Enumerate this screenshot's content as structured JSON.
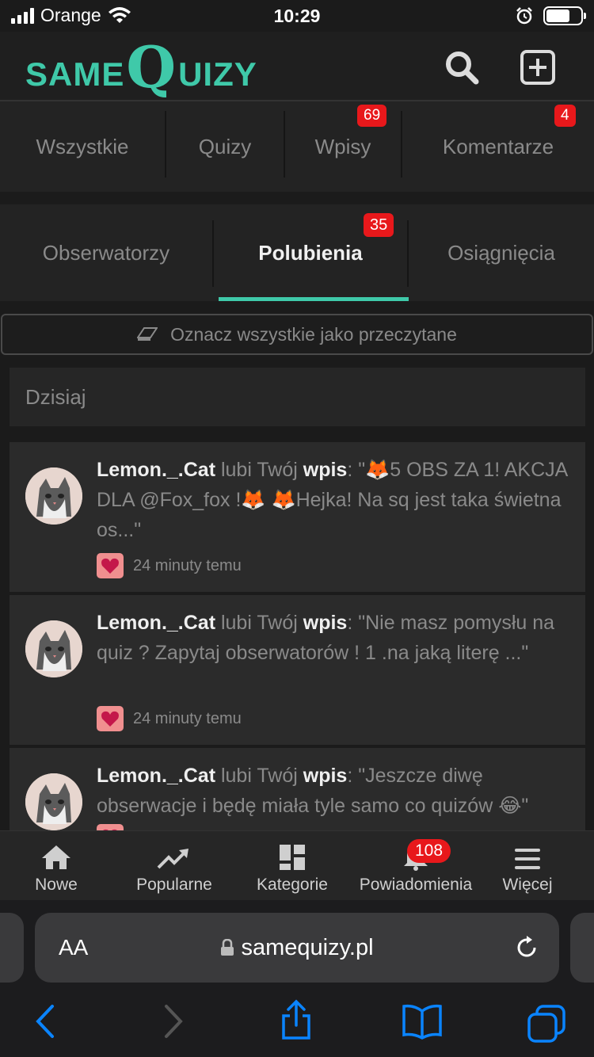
{
  "status_bar": {
    "carrier": "Orange",
    "time": "10:29"
  },
  "header": {
    "logo_same": "SAME",
    "logo_q": "Q",
    "logo_uizy": "UIZY"
  },
  "tabs_top": [
    {
      "label": "Wszystkie",
      "badge": ""
    },
    {
      "label": "Quizy",
      "badge": ""
    },
    {
      "label": "Wpisy",
      "badge": "69"
    },
    {
      "label": "Komentarze",
      "badge": "4"
    }
  ],
  "tabs_sub": [
    {
      "label": "Obserwatorzy",
      "badge": "",
      "active": false
    },
    {
      "label": "Polubienia",
      "badge": "35",
      "active": true
    },
    {
      "label": "Osiągnięcia",
      "badge": "",
      "active": false
    }
  ],
  "mark_all_label": "Oznacz wszystkie jako przeczytane",
  "day_header": "Dzisiaj",
  "notifications": [
    {
      "user": "Lemon._.Cat",
      "action": " lubi Twój ",
      "target": "wpis",
      "quote": ": \"🦊5 OBS ZA 1! AKCJA DLA @Fox_fox !🦊 🦊Hejka! Na sq jest taka świetna os...\"",
      "time": "24 minuty temu"
    },
    {
      "user": "Lemon._.Cat",
      "action": " lubi Twój ",
      "target": "wpis",
      "quote": ": \"Nie masz pomysłu na quiz ? Zapytaj obserwatorów ! 1 .na jaką literę ...\"",
      "time": "24 minuty temu"
    },
    {
      "user": "Lemon._.Cat",
      "action": " lubi Twój ",
      "target": "wpis",
      "quote": ": \"Jeszcze diwę obserwacje i będę miała tyle samo co quizów 😂\"",
      "time": ""
    }
  ],
  "bottom_nav": [
    {
      "label": "Nowe",
      "icon": "home-icon",
      "badge": ""
    },
    {
      "label": "Popularne",
      "icon": "trending-icon",
      "badge": ""
    },
    {
      "label": "Kategorie",
      "icon": "grid-icon",
      "badge": ""
    },
    {
      "label": "Powiadomienia",
      "icon": "bell-icon",
      "badge": "108"
    },
    {
      "label": "Więcej",
      "icon": "menu-icon",
      "badge": ""
    }
  ],
  "browser": {
    "text_size": "AA",
    "url": "samequizy.pl"
  },
  "colors": {
    "accent": "#3fc9a9",
    "badge": "#e8181b",
    "background": "#1b1b1b",
    "ios_blue": "#0a84ff"
  }
}
